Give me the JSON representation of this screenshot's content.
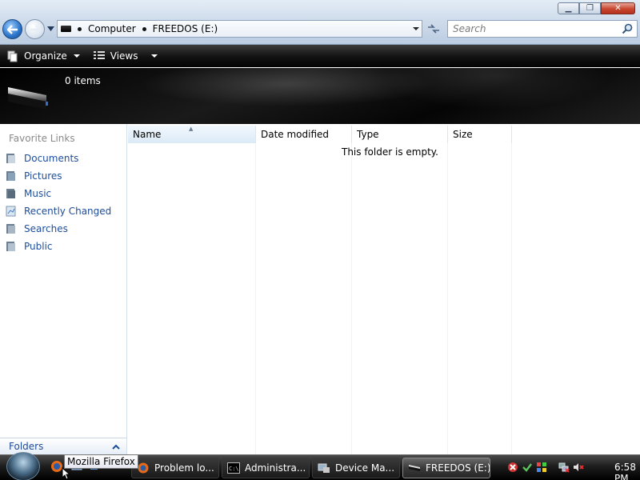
{
  "window": {
    "controls": {
      "minimize": "▁",
      "maximize": "❐",
      "close": "✕"
    }
  },
  "address": {
    "crumbs": [
      "Computer",
      "FREEDOS (E:)"
    ]
  },
  "search": {
    "placeholder": "Search"
  },
  "commandbar": {
    "organize_label": "Organize",
    "views_label": "Views"
  },
  "details": {
    "count": "0 items"
  },
  "nav": {
    "favorites_header": "Favorite Links",
    "items": [
      {
        "label": "Documents",
        "icon": "documents-icon"
      },
      {
        "label": "Pictures",
        "icon": "pictures-icon"
      },
      {
        "label": "Music",
        "icon": "music-icon"
      },
      {
        "label": "Recently Changed",
        "icon": "recently-changed-icon"
      },
      {
        "label": "Searches",
        "icon": "searches-icon"
      },
      {
        "label": "Public",
        "icon": "public-icon"
      }
    ],
    "folders_label": "Folders"
  },
  "filelist": {
    "columns": [
      "Name",
      "Date modified",
      "Type",
      "Size"
    ],
    "sorted_column": "Name",
    "empty_message": "This folder is empty."
  },
  "taskbar": {
    "tooltip": "Mozilla Firefox",
    "buttons": [
      {
        "label": "Problem lo...",
        "icon": "firefox-icon"
      },
      {
        "label": "Administra...",
        "icon": "cmd-icon"
      },
      {
        "label": "Device Ma...",
        "icon": "device-manager-icon"
      },
      {
        "label": "FREEDOS (E:)",
        "icon": "drive-icon",
        "active": true
      }
    ],
    "clock": "6:58 PM"
  },
  "colors": {
    "link_blue": "#1c4d9c",
    "command_bar": "#121212",
    "title_gradient_top": "#e3edf6"
  }
}
